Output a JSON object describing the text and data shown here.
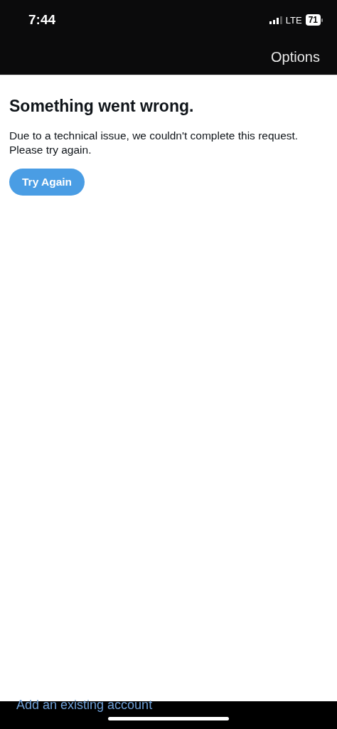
{
  "status_bar": {
    "time": "7:44",
    "network": "LTE",
    "battery": "71"
  },
  "nav_bar": {
    "action": "Options"
  },
  "error": {
    "title": "Something went wrong.",
    "message": "Due to a technical issue, we couldn't complete this request. Please try again.",
    "button": "Try Again"
  },
  "footer": {
    "link": "Add an existing account"
  }
}
